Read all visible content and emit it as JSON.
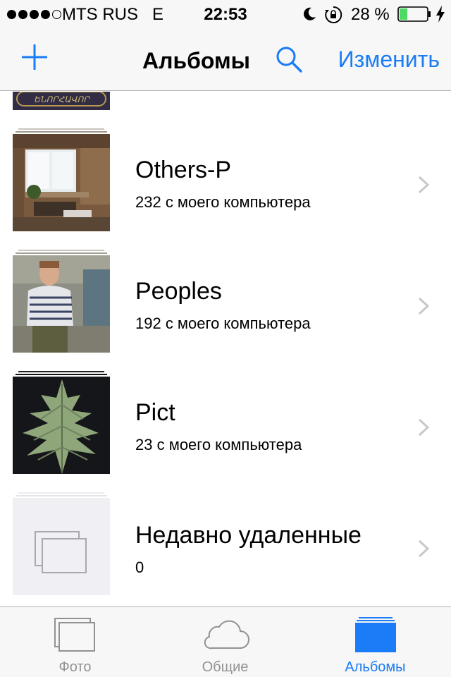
{
  "status_bar": {
    "carrier": "MTS RUS",
    "network": "E",
    "time": "22:53",
    "battery": "28 %",
    "icons": [
      "signal-dots",
      "moon-icon",
      "rotation-lock-icon",
      "battery-icon",
      "charging-icon"
    ]
  },
  "nav": {
    "title": "Альбомы",
    "edit_label": "Изменить",
    "add_icon": "plus-icon",
    "search_icon": "search-icon",
    "accent_color": "#1a7cf6"
  },
  "albums": [
    {
      "title": "Others-P",
      "subtitle": "232 с моего компьютера"
    },
    {
      "title": "Peoples",
      "subtitle": "192 с моего компьютера"
    },
    {
      "title": "Pict",
      "subtitle": "23 с моего компьютера"
    },
    {
      "title": "Недавно удаленные",
      "subtitle": "0"
    }
  ],
  "partial_album_text": "ԵՆՈՐՀԱՎՈՐ",
  "tabs": [
    {
      "label": "Фото",
      "icon": "photos-icon",
      "active": false
    },
    {
      "label": "Общие",
      "icon": "cloud-icon",
      "active": false
    },
    {
      "label": "Альбомы",
      "icon": "albums-icon",
      "active": true
    }
  ]
}
